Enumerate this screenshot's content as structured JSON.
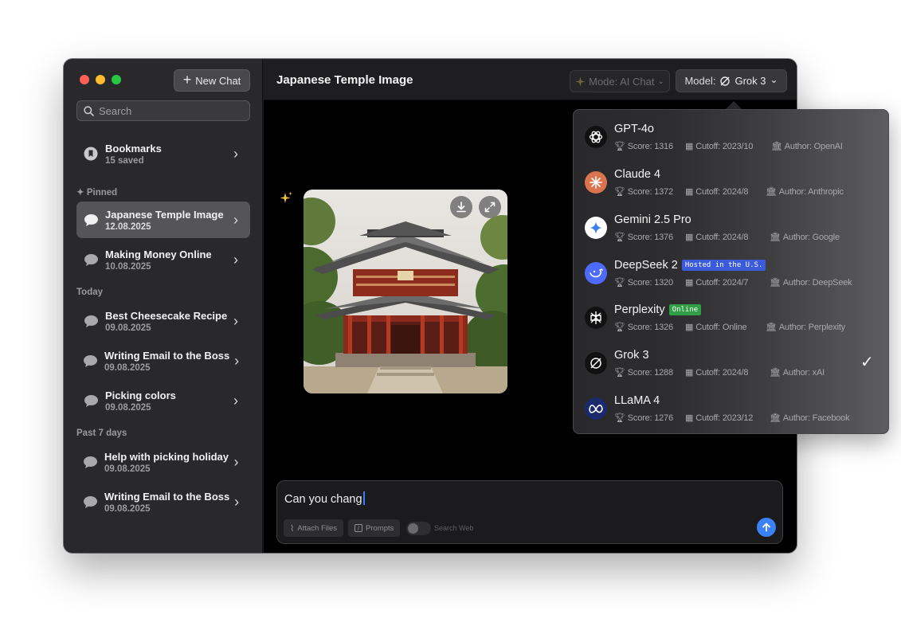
{
  "sidebar": {
    "new_chat_label": "New Chat",
    "search_placeholder": "Search",
    "bookmarks": {
      "title": "Bookmarks",
      "subtitle": "15 saved"
    },
    "pinned_label": "Pinned",
    "today_label": "Today",
    "past_label": "Past 7 days",
    "items": [
      {
        "title": "Japanese Temple Image",
        "date": "12.08.2025",
        "active": true
      },
      {
        "title": "Making Money Online",
        "date": "10.08.2025"
      },
      {
        "title": "Best Cheesecake Recipe",
        "date": "09.08.2025"
      },
      {
        "title": "Writing Email to the Boss",
        "date": "09.08.2025"
      },
      {
        "title": "Picking colors",
        "date": "09.08.2025"
      },
      {
        "title": "Help with picking holiday",
        "date": "09.08.2025"
      },
      {
        "title": "Writing Email to the Boss",
        "date": "09.08.2025"
      }
    ]
  },
  "header": {
    "title": "Japanese Temple Image",
    "mode_label": "Mode: AI Chat",
    "model_prefix": "Model:",
    "model_value": "Grok 3"
  },
  "composer": {
    "text": "Can you chang",
    "attach_label": "Attach Files",
    "prompts_label": "Prompts",
    "search_web_label": "Search Web",
    "search_web_on": false
  },
  "models": [
    {
      "name": "GPT-4o",
      "score": "Score: 1316",
      "cutoff": "Cutoff: 2023/10",
      "author": "Author: OpenAI",
      "badge": "",
      "logo_bg": "#111111",
      "icon": "openai-logo-icon"
    },
    {
      "name": "Claude 4",
      "score": "Score: 1372",
      "cutoff": "Cutoff: 2024/8",
      "author": "Author: Anthropic",
      "badge": "",
      "logo_bg": "#d9744f",
      "icon": "claude-logo-icon"
    },
    {
      "name": "Gemini 2.5 Pro",
      "score": "Score: 1376",
      "cutoff": "Cutoff: 2024/8",
      "author": "Author: Google",
      "badge": "",
      "logo_bg": "#ffffff",
      "icon": "gemini-logo-icon"
    },
    {
      "name": "DeepSeek 2",
      "score": "Score: 1320",
      "cutoff": "Cutoff: 2024/7",
      "author": "Author: DeepSeek",
      "badge": "Hosted in the U.S.",
      "badge_color": "#3b5bdb",
      "logo_bg": "#4d6bfe",
      "icon": "deepseek-logo-icon"
    },
    {
      "name": "Perplexity",
      "score": "Score: 1326",
      "cutoff": "Cutoff: Online",
      "author": "Author: Perplexity",
      "badge": "Online",
      "badge_color": "#2f9e44",
      "logo_bg": "#111111",
      "icon": "perplexity-logo-icon"
    },
    {
      "name": "Grok 3",
      "score": "Score: 1288",
      "cutoff": "Cutoff: 2024/8",
      "author": "Author: xAI",
      "badge": "",
      "logo_bg": "#111111",
      "icon": "grok-logo-icon",
      "selected": true
    },
    {
      "name": "LLaMA 4",
      "score": "Score: 1276",
      "cutoff": "Cutoff: 2023/12",
      "author": "Author: Facebook",
      "badge": "",
      "logo_bg": "#1a2a6c",
      "icon": "meta-logo-icon"
    }
  ],
  "colors": {
    "accent": "#3a82f6",
    "active_item": "#555558"
  }
}
